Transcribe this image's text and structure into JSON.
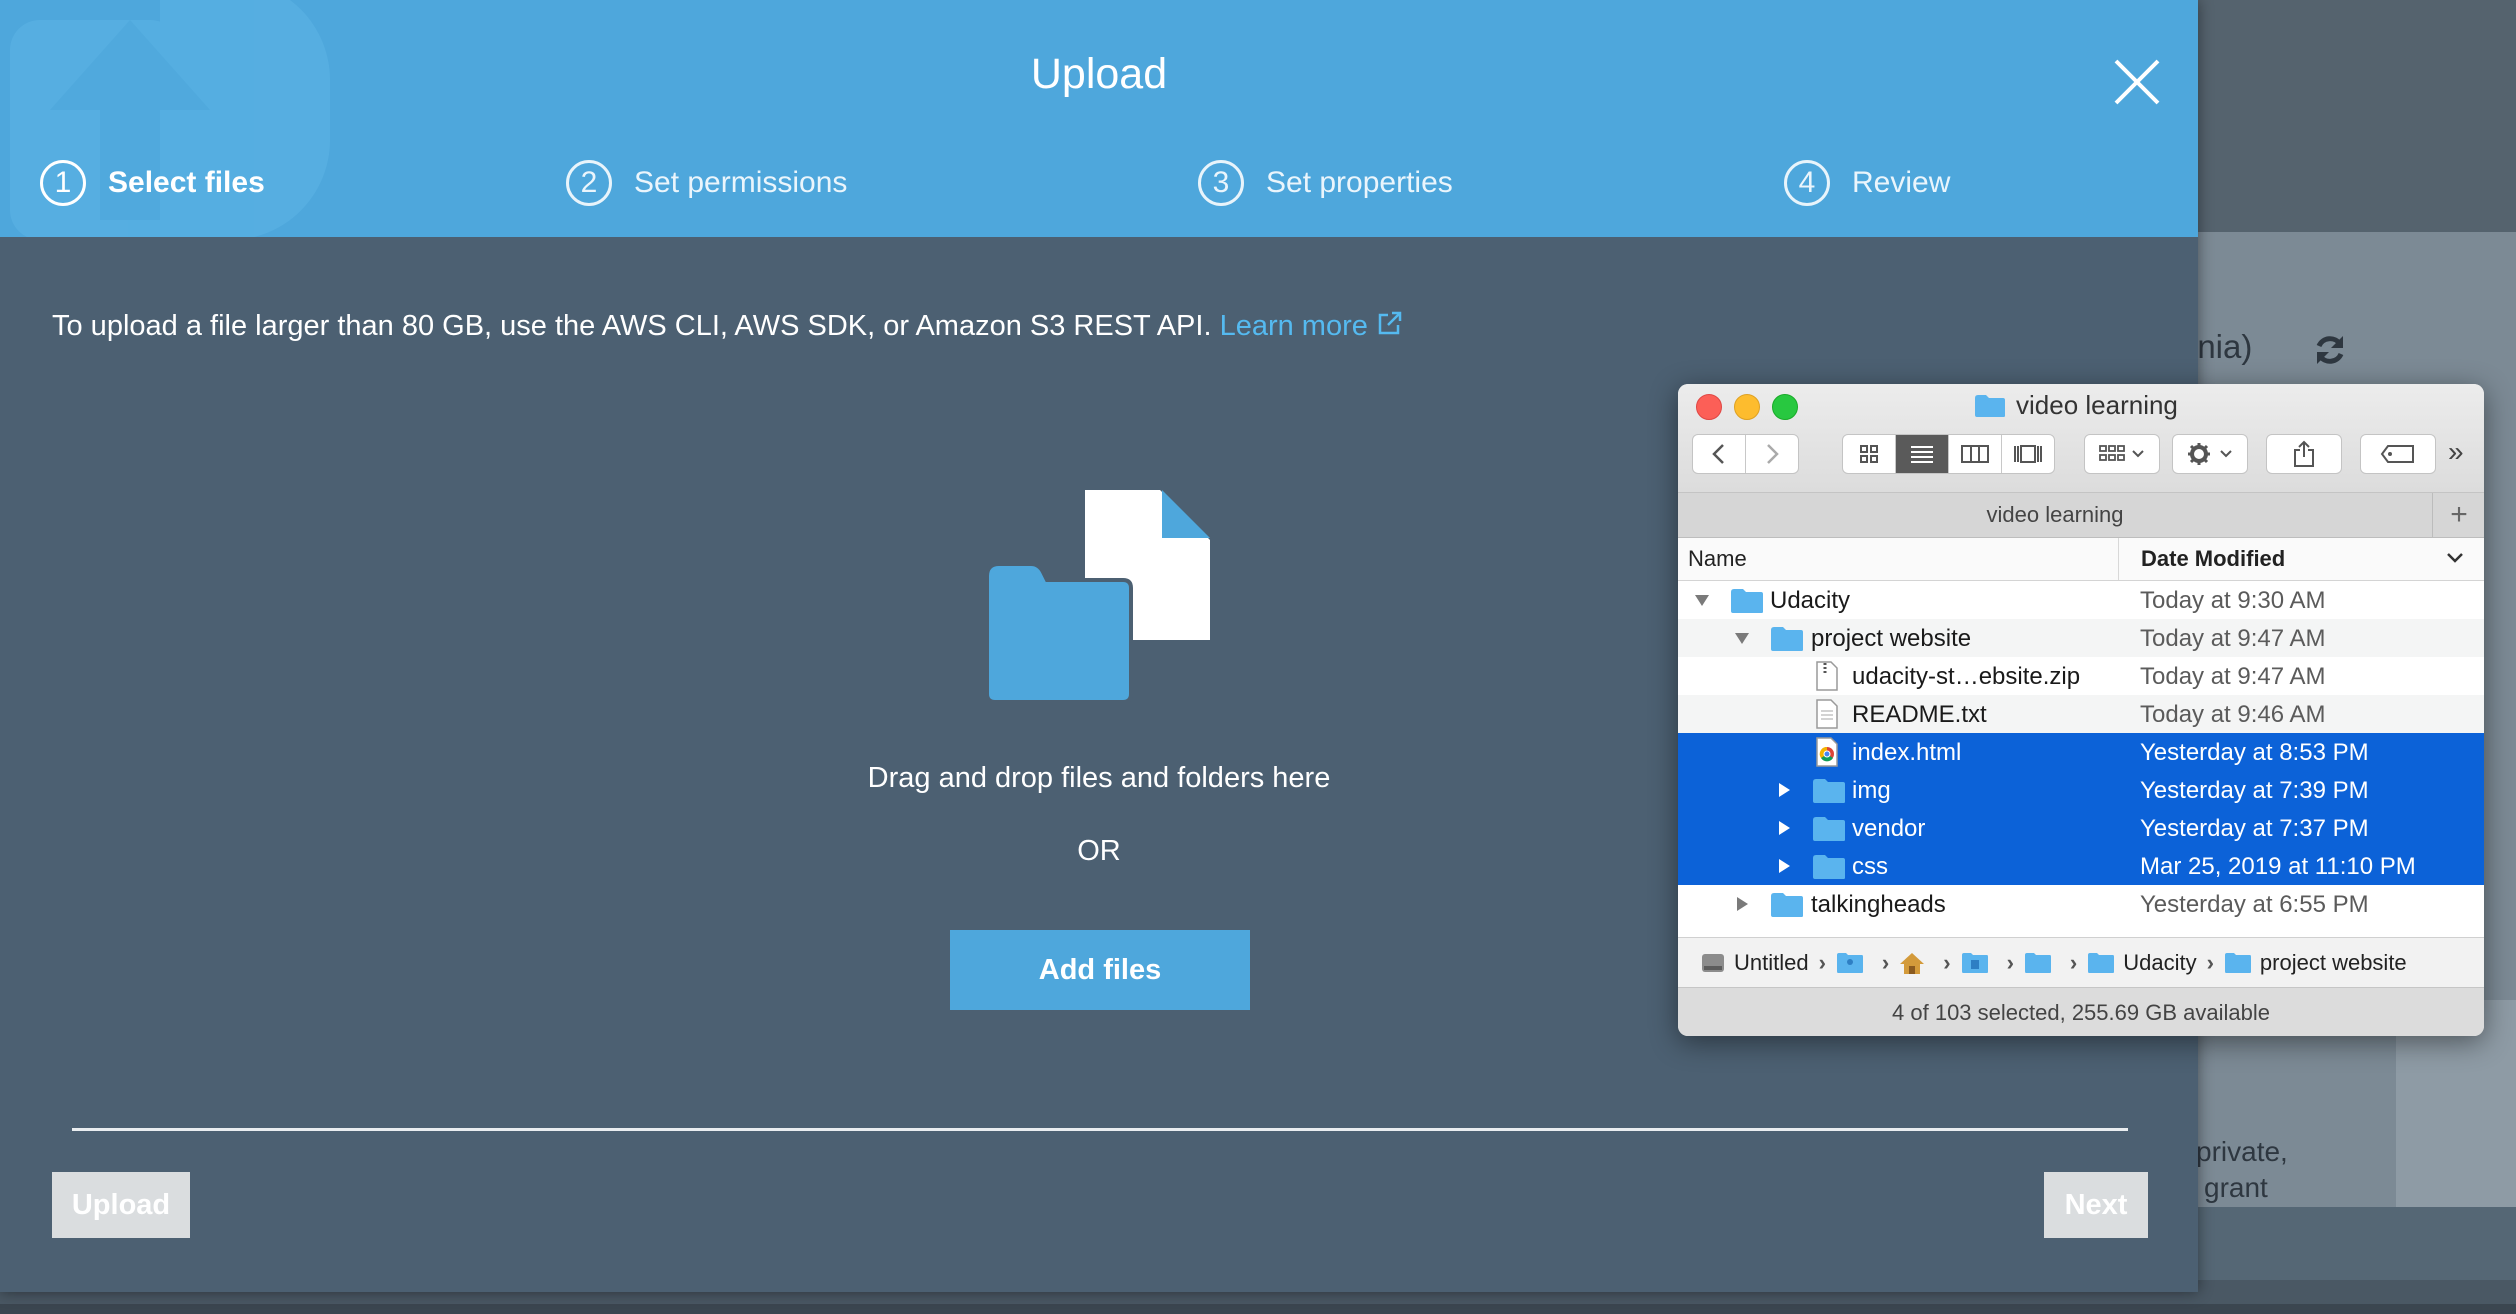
{
  "background": {
    "text_fragment_1": "inia)",
    "text_fragment_2": "private,",
    "text_fragment_3": "grant"
  },
  "modal": {
    "title": "Upload",
    "steps": [
      {
        "number": "1",
        "label": "Select files",
        "active": true
      },
      {
        "number": "2",
        "label": "Set permissions",
        "active": false
      },
      {
        "number": "3",
        "label": "Set properties",
        "active": false
      },
      {
        "number": "4",
        "label": "Review",
        "active": false
      }
    ],
    "notice": "To upload a file larger than 80 GB, use the AWS CLI, AWS SDK, or Amazon S3 REST API.",
    "learn_more": "Learn more",
    "drag_text": "Drag and drop files and folders here",
    "or_text": "OR",
    "add_files_label": "Add files",
    "upload_label": "Upload",
    "next_label": "Next",
    "colors": {
      "header": "#4ea7dc",
      "body": "#4c6072",
      "link": "#55baf0",
      "disabled_button": "#dadddf"
    }
  },
  "finder": {
    "title": "video learning",
    "path_tab": "video learning",
    "column_name": "Name",
    "column_date": "Date Modified",
    "rows": [
      {
        "name": "Udacity",
        "date": "Today at 9:30 AM",
        "icon": "folder-icon",
        "disclosure": "expanded",
        "selected": false
      },
      {
        "name": "project website",
        "date": "Today at 9:47 AM",
        "icon": "folder-icon",
        "disclosure": "expanded",
        "selected": false
      },
      {
        "name": "udacity-st…ebsite.zip",
        "date": "Today at 9:47 AM",
        "icon": "zip-file-icon",
        "disclosure": "none",
        "selected": false
      },
      {
        "name": "README.txt",
        "date": "Today at 9:46 AM",
        "icon": "text-file-icon",
        "disclosure": "none",
        "selected": false
      },
      {
        "name": "index.html",
        "date": "Yesterday at 8:53 PM",
        "icon": "chrome-html-icon",
        "disclosure": "none",
        "selected": true
      },
      {
        "name": "img",
        "date": "Yesterday at 7:39 PM",
        "icon": "folder-icon",
        "disclosure": "collapsed",
        "selected": true
      },
      {
        "name": "vendor",
        "date": "Yesterday at 7:37 PM",
        "icon": "folder-icon",
        "disclosure": "collapsed",
        "selected": true
      },
      {
        "name": "css",
        "date": "Mar 25, 2019 at 11:10 PM",
        "icon": "folder-icon",
        "disclosure": "collapsed",
        "selected": true
      },
      {
        "name": "talkingheads",
        "date": "Yesterday at 6:55 PM",
        "icon": "folder-icon",
        "disclosure": "collapsed",
        "selected": false
      }
    ],
    "path_bar": {
      "disk": "Untitled",
      "folder_1": "Udacity",
      "folder_2": "project website"
    },
    "status": "4 of 103 selected, 255.69 GB available",
    "colors": {
      "selection": "#0c62d8",
      "folder": "#5ab4ee"
    }
  }
}
